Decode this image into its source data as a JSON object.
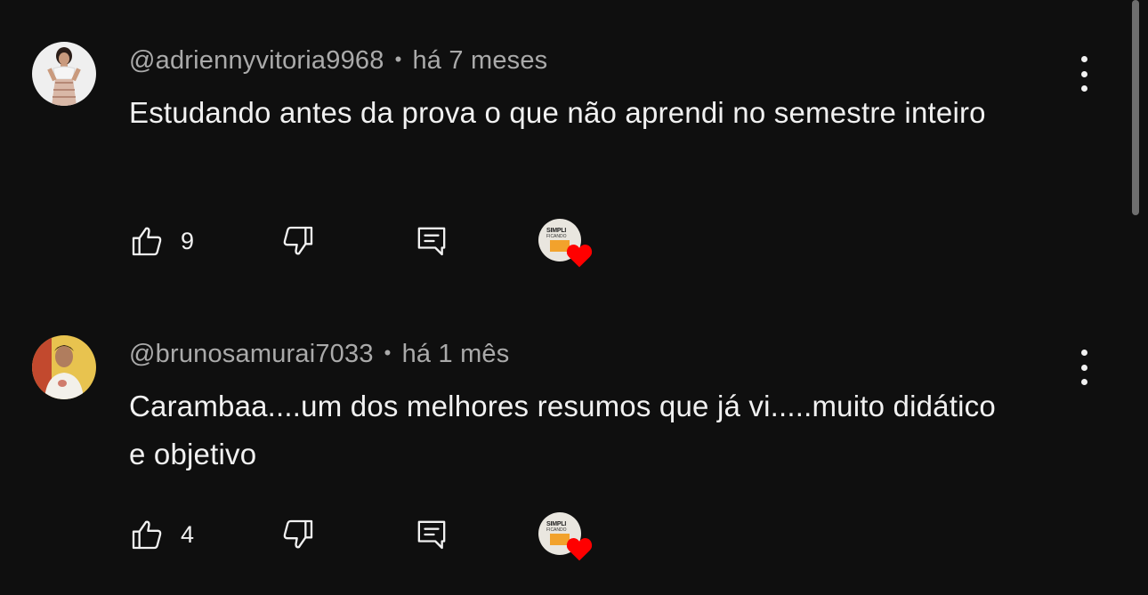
{
  "comments": [
    {
      "author": "@adriennyvitoria9968",
      "time": "há 7 meses",
      "text": "Estudando antes da prova o que não aprendi no semestre inteiro",
      "likes": "9",
      "creator_heart": true
    },
    {
      "author": "@brunosamurai7033",
      "time": "há 1 mês",
      "text": "Carambaa....um dos melhores resumos que já vi.....muito didático e objetivo",
      "likes": "4",
      "creator_heart": true
    }
  ],
  "separator": "•",
  "creator_logo": {
    "line1": "SIMPLI",
    "line2": "FICANDO"
  },
  "icons": {
    "like": "thumb-up-icon",
    "dislike": "thumb-down-icon",
    "reply": "comment-reply-icon",
    "more": "more-vertical-icon",
    "heart": "heart-icon"
  },
  "colors": {
    "background": "#0f0f0f",
    "text": "#f1f1f1",
    "secondary_text": "#aaaaaa",
    "heart": "#ff0000"
  }
}
